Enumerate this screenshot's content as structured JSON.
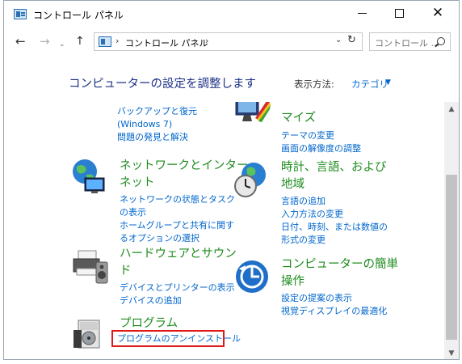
{
  "window": {
    "title": "コントロール パネル"
  },
  "nav": {
    "back": "←",
    "forward": "→",
    "recent": "⌄",
    "up": "↑",
    "separator": "›",
    "breadcrumb": "コントロール パネル",
    "dropdown": "⌄",
    "refresh": "↻",
    "search_placeholder": "コントロール ..."
  },
  "header": {
    "title": "コンピューターの設定を調整します",
    "view_by_label": "表示方法:",
    "view_by_value": "カテゴリ",
    "view_by_arrow": "▼"
  },
  "categories": {
    "system": {
      "links": [
        "バックアップと復元",
        "(Windows 7)",
        "問題の発見と解決"
      ]
    },
    "appearance": {
      "title_lines": [
        "マイズ"
      ],
      "links": [
        "テーマの変更",
        "画面の解像度の調整"
      ]
    },
    "network": {
      "title_lines": [
        "ネットワークとインター",
        "ネット"
      ],
      "links": [
        "ネットワークの状態とタスク",
        "の表示",
        "ホームグループと共有に関す",
        "るオプションの選択"
      ]
    },
    "clock": {
      "title_lines": [
        "時計、言語、および",
        "地域"
      ],
      "links": [
        "言語の追加",
        "入力方法の変更",
        "日付、時刻、または数値の",
        "形式の変更"
      ]
    },
    "hardware": {
      "title_lines": [
        "ハードウェアとサウン",
        "ド"
      ],
      "links": [
        "デバイスとプリンターの表示",
        "デバイスの追加"
      ]
    },
    "ease": {
      "title_lines": [
        "コンピューターの簡単",
        "操作"
      ],
      "links": [
        "設定の提案の表示",
        "視覚ディスプレイの最適化"
      ]
    },
    "programs": {
      "title_lines": [
        "プログラム"
      ],
      "links": [
        "プログラムのアンインストール"
      ]
    }
  },
  "scrollbar": {
    "up": "▲",
    "down": "▼"
  },
  "colors": {
    "category_title": "#1e8c1e",
    "link": "#0066cc",
    "page_title": "#1e3287",
    "highlight": "#e01818"
  }
}
